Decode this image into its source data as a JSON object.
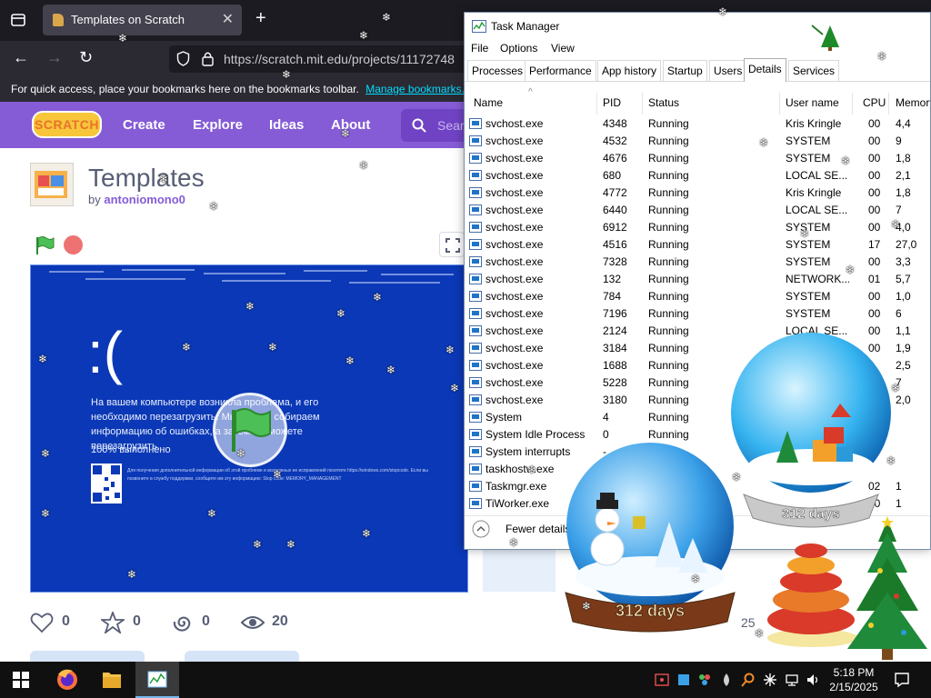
{
  "browser": {
    "tab_title": "Templates on Scratch",
    "url": "https://scratch.mit.edu/projects/11172748",
    "bookmarks_text": "For quick access, place your bookmarks here on the bookmarks toolbar.",
    "bookmarks_link": "Manage bookmarks..."
  },
  "scratch": {
    "logo": "SCRATCH",
    "nav": [
      "Create",
      "Explore",
      "Ideas",
      "About"
    ],
    "search_placeholder": "Sear",
    "project_title": "Templates",
    "author_prefix": "by",
    "author": "antoniomono0",
    "bsod": {
      "face": ":(",
      "message": "На вашем компьютере возникла проблема, и его необходимо перезагрузить. Мы просто собираем информацию об ошибках, а затем вы можете перезагрузить.",
      "progress": "100% выполнено",
      "fine_print": "Для получения дополнительной информации об этой проблеме и возможных ее исправлений посетите https://windows.com/stopcode. Если вы позвоните в службу поддержки, сообщите им эту информацию: Stop code: MEMORY_MANAGEMENT"
    },
    "stats": {
      "loves": "0",
      "favorites": "0",
      "remixes": "0",
      "views": "20"
    },
    "side_number": "25"
  },
  "task_manager": {
    "title": "Task Manager",
    "menu": [
      "File",
      "Options",
      "View"
    ],
    "tabs": [
      "Processes",
      "Performance",
      "App history",
      "Startup",
      "Users",
      "Details",
      "Services"
    ],
    "active_tab": "Details",
    "columns": [
      "Name",
      "PID",
      "Status",
      "User name",
      "CPU",
      "Memory"
    ],
    "rows": [
      {
        "name": "svchost.exe",
        "pid": "4348",
        "status": "Running",
        "user": "Kris Kringle",
        "cpu": "00",
        "mem": "4,4"
      },
      {
        "name": "svchost.exe",
        "pid": "4532",
        "status": "Running",
        "user": "SYSTEM",
        "cpu": "00",
        "mem": "9"
      },
      {
        "name": "svchost.exe",
        "pid": "4676",
        "status": "Running",
        "user": "SYSTEM",
        "cpu": "00",
        "mem": "1,8"
      },
      {
        "name": "svchost.exe",
        "pid": "680",
        "status": "Running",
        "user": "LOCAL SE...",
        "cpu": "00",
        "mem": "2,1"
      },
      {
        "name": "svchost.exe",
        "pid": "4772",
        "status": "Running",
        "user": "Kris Kringle",
        "cpu": "00",
        "mem": "1,8"
      },
      {
        "name": "svchost.exe",
        "pid": "6440",
        "status": "Running",
        "user": "LOCAL SE...",
        "cpu": "00",
        "mem": "7"
      },
      {
        "name": "svchost.exe",
        "pid": "6912",
        "status": "Running",
        "user": "SYSTEM",
        "cpu": "00",
        "mem": "4,0"
      },
      {
        "name": "svchost.exe",
        "pid": "4516",
        "status": "Running",
        "user": "SYSTEM",
        "cpu": "17",
        "mem": "27,0"
      },
      {
        "name": "svchost.exe",
        "pid": "7328",
        "status": "Running",
        "user": "SYSTEM",
        "cpu": "00",
        "mem": "3,3"
      },
      {
        "name": "svchost.exe",
        "pid": "132",
        "status": "Running",
        "user": "NETWORK...",
        "cpu": "01",
        "mem": "5,7"
      },
      {
        "name": "svchost.exe",
        "pid": "784",
        "status": "Running",
        "user": "SYSTEM",
        "cpu": "00",
        "mem": "1,0"
      },
      {
        "name": "svchost.exe",
        "pid": "7196",
        "status": "Running",
        "user": "SYSTEM",
        "cpu": "00",
        "mem": "6"
      },
      {
        "name": "svchost.exe",
        "pid": "2124",
        "status": "Running",
        "user": "LOCAL SE...",
        "cpu": "00",
        "mem": "1,1"
      },
      {
        "name": "svchost.exe",
        "pid": "3184",
        "status": "Running",
        "user": "SYSTEM",
        "cpu": "00",
        "mem": "1,9"
      },
      {
        "name": "svchost.exe",
        "pid": "1688",
        "status": "Running",
        "user": "",
        "cpu": "",
        "mem": "2,5"
      },
      {
        "name": "svchost.exe",
        "pid": "5228",
        "status": "Running",
        "user": "",
        "cpu": "",
        "mem": "7"
      },
      {
        "name": "svchost.exe",
        "pid": "3180",
        "status": "Running",
        "user": "",
        "cpu": "",
        "mem": "2,0"
      },
      {
        "name": "System",
        "pid": "4",
        "status": "Running",
        "user": "",
        "cpu": "",
        "mem": ""
      },
      {
        "name": "System Idle Process",
        "pid": "0",
        "status": "Running",
        "user": "",
        "cpu": "",
        "mem": ""
      },
      {
        "name": "System interrupts",
        "pid": "-",
        "status": "",
        "user": "",
        "cpu": "",
        "mem": ""
      },
      {
        "name": "taskhostw.exe",
        "pid": "",
        "status": "",
        "user": "",
        "cpu": "",
        "mem": ""
      },
      {
        "name": "Taskmgr.exe",
        "pid": "",
        "status": "",
        "user": "",
        "cpu": "02",
        "mem": "1"
      },
      {
        "name": "TiWorker.exe",
        "pid": "",
        "status": "",
        "user": "",
        "cpu": "00",
        "mem": "1"
      }
    ],
    "footer": "Fewer details"
  },
  "decorations": {
    "globe_left_label": "312 days",
    "globe_right_label": "312 days"
  },
  "taskbar": {
    "time": "5:18 PM",
    "date": "2/15/2025"
  }
}
